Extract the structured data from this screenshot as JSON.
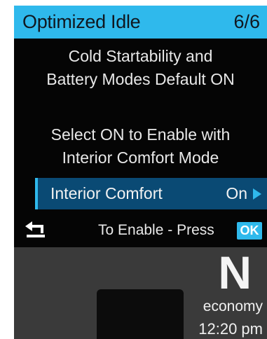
{
  "header": {
    "title": "Optimized Idle",
    "page_indicator": "6/6"
  },
  "message": {
    "line1": "Cold Startability and",
    "line2": "Battery Modes Default ON",
    "line3": "Select ON to Enable with",
    "line4": "Interior Comfort Mode"
  },
  "option": {
    "label": "Interior Comfort",
    "value": "On"
  },
  "footer": {
    "hint": "To Enable - Press",
    "ok_label": "OK"
  },
  "status": {
    "gear": "N",
    "mode": "economy",
    "time": "12:20 pm"
  },
  "colors": {
    "accent": "#2fb9ec",
    "selected_row": "#0a4a74",
    "screen_background": "#050505",
    "lower_panel": "#3a3a3a"
  },
  "icons": {
    "back": "back-arrow-icon",
    "next": "right-triangle-icon"
  }
}
